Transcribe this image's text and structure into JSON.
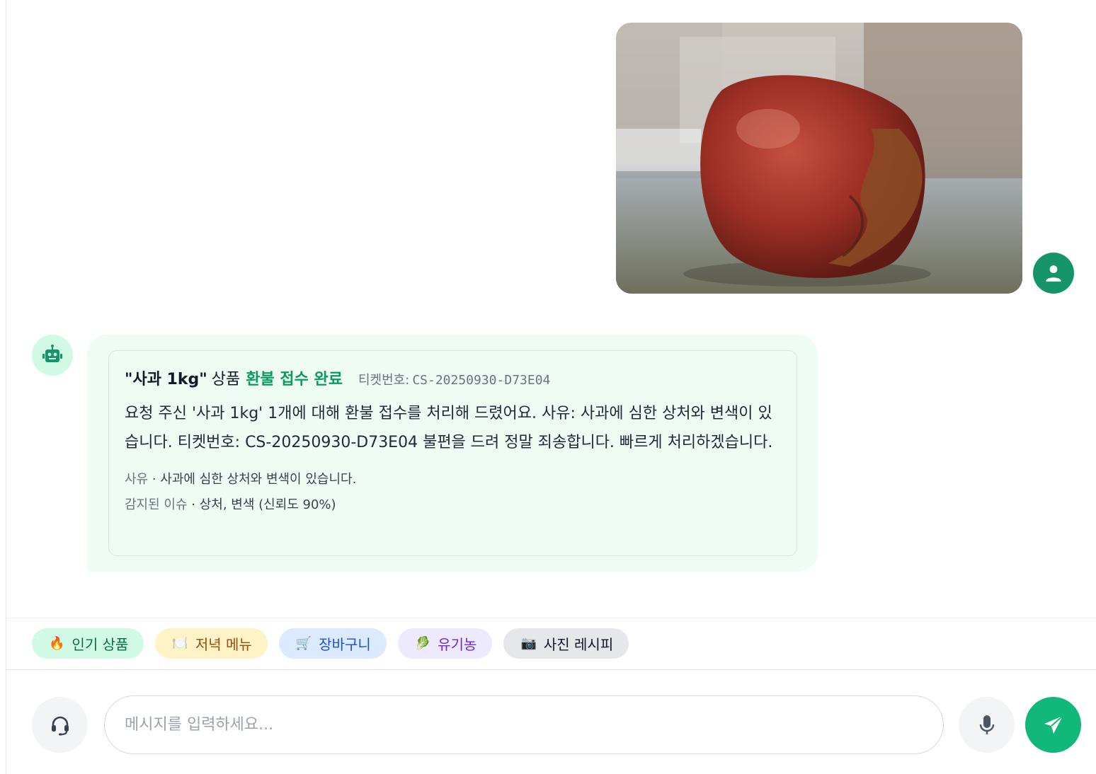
{
  "user_message": {
    "image_alt": "damaged red apple photo",
    "avatar_icon": "user-icon"
  },
  "bot_message": {
    "avatar_icon": "robot-icon",
    "product_quote": "\"사과 1kg\"",
    "product_suffix": "상품",
    "status": "환불 접수 완료",
    "ticket_label": "티켓번호:",
    "ticket_no": "CS-20250930-D73E04",
    "body": "요청 주신 '사과 1kg' 1개에 대해 환불 접수를 처리해 드렸어요. 사유: 사과에 심한 상처와 변색이 있습니다. 티켓번호: CS-20250930-D73E04 불편을 드려 정말 죄송합니다. 빠르게 처리하겠습니다.",
    "reason_key": "사유",
    "reason_value": "사과에 심한 상처와 변색이 있습니다.",
    "issue_key": "감지된 이슈",
    "issue_value": "상처, 변색 (신뢰도 90%)",
    "separator": " · "
  },
  "quick_chips": [
    {
      "emoji": "🔥",
      "label": "인기 상품"
    },
    {
      "emoji": "🍽️",
      "label": "저녁 메뉴"
    },
    {
      "emoji": "🛒",
      "label": "장바구니"
    },
    {
      "emoji": "🥬",
      "label": "유기농"
    },
    {
      "emoji": "📷",
      "label": "사진 레시피"
    }
  ],
  "composer": {
    "placeholder": "메시지를 입력하세요...",
    "support_icon": "headset-icon",
    "mic_icon": "microphone-icon",
    "send_icon": "send-icon"
  },
  "colors": {
    "accent": "#12b77a",
    "user_avatar": "#15946a",
    "status_green": "#0c9a5e",
    "bot_bubble": "#effcf4"
  }
}
